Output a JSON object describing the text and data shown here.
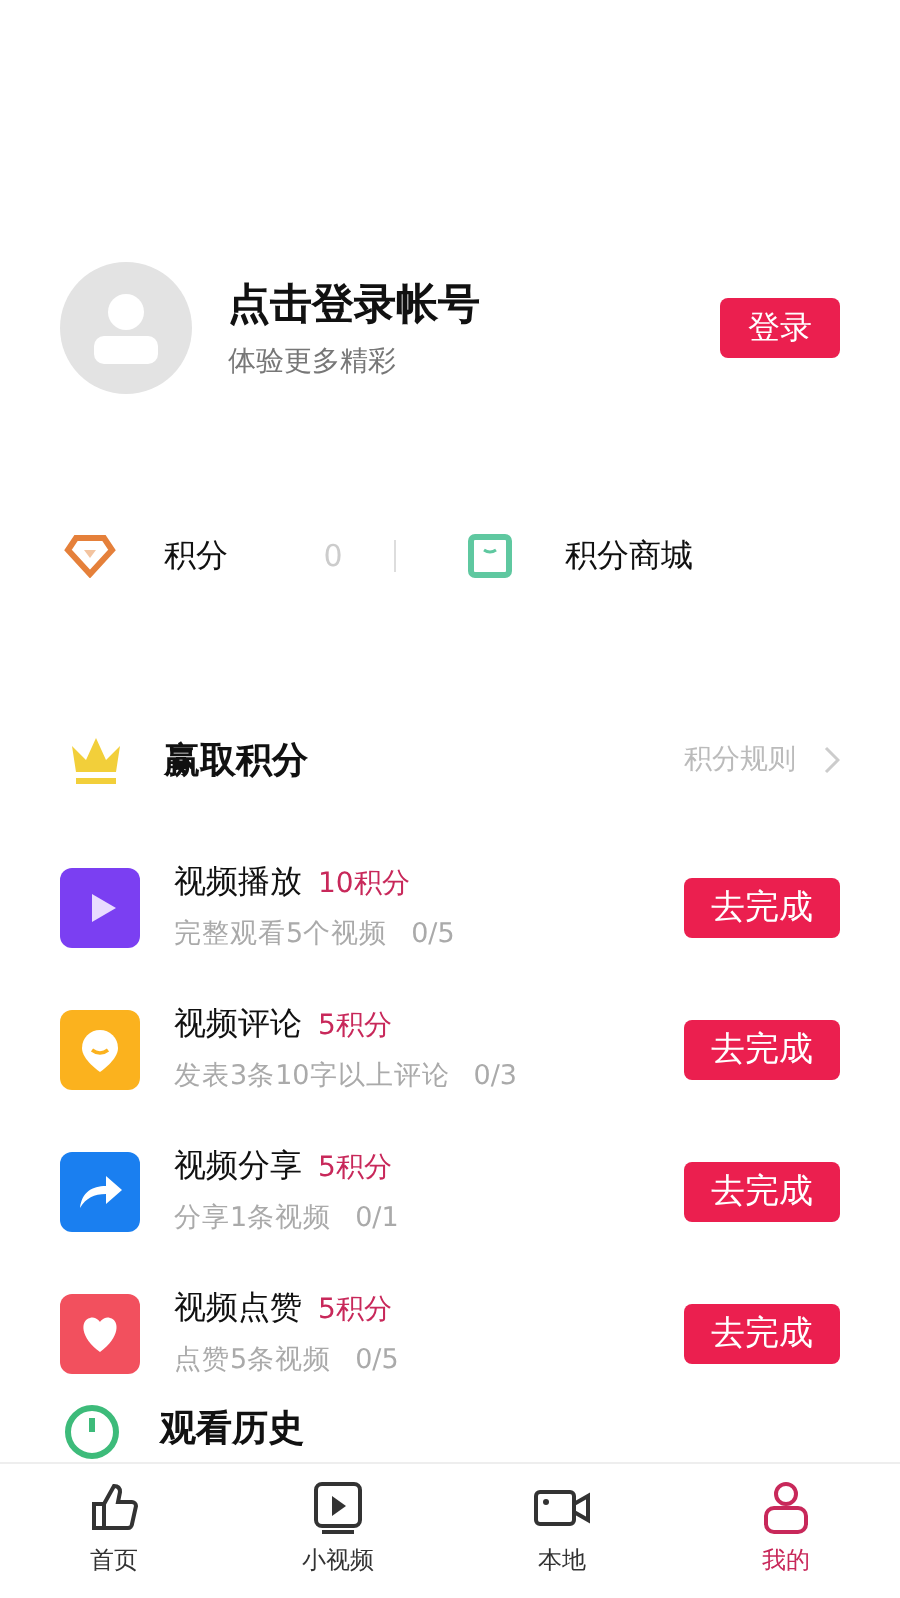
{
  "profile": {
    "title": "点击登录帐号",
    "subtitle": "体验更多精彩",
    "login_button": "登录"
  },
  "points": {
    "label": "积分",
    "value": "0",
    "shop": "积分商城"
  },
  "earn": {
    "title": "赢取积分",
    "rules_link": "积分规则"
  },
  "tasks": [
    {
      "kind": "play",
      "name": "视频播放",
      "reward": "10积分",
      "desc": "完整观看5个视频",
      "progress": "0/5",
      "button": "去完成",
      "color": "#7b3ff2"
    },
    {
      "kind": "comment",
      "name": "视频评论",
      "reward": "5积分",
      "desc": "发表3条10字以上评论",
      "progress": "0/3",
      "button": "去完成",
      "color": "#fbb21e"
    },
    {
      "kind": "share",
      "name": "视频分享",
      "reward": "5积分",
      "desc": "分享1条视频",
      "progress": "0/1",
      "button": "去完成",
      "color": "#1a7ff0"
    },
    {
      "kind": "like",
      "name": "视频点赞",
      "reward": "5积分",
      "desc": "点赞5条视频",
      "progress": "0/5",
      "button": "去完成",
      "color": "#f2505e"
    }
  ],
  "history": {
    "label": "观看历史"
  },
  "tabs": [
    {
      "kind": "home",
      "label": "首页",
      "selected": false
    },
    {
      "kind": "video",
      "label": "小视频",
      "selected": false
    },
    {
      "kind": "local",
      "label": "本地",
      "selected": false
    },
    {
      "kind": "mine",
      "label": "我的",
      "selected": true
    }
  ]
}
